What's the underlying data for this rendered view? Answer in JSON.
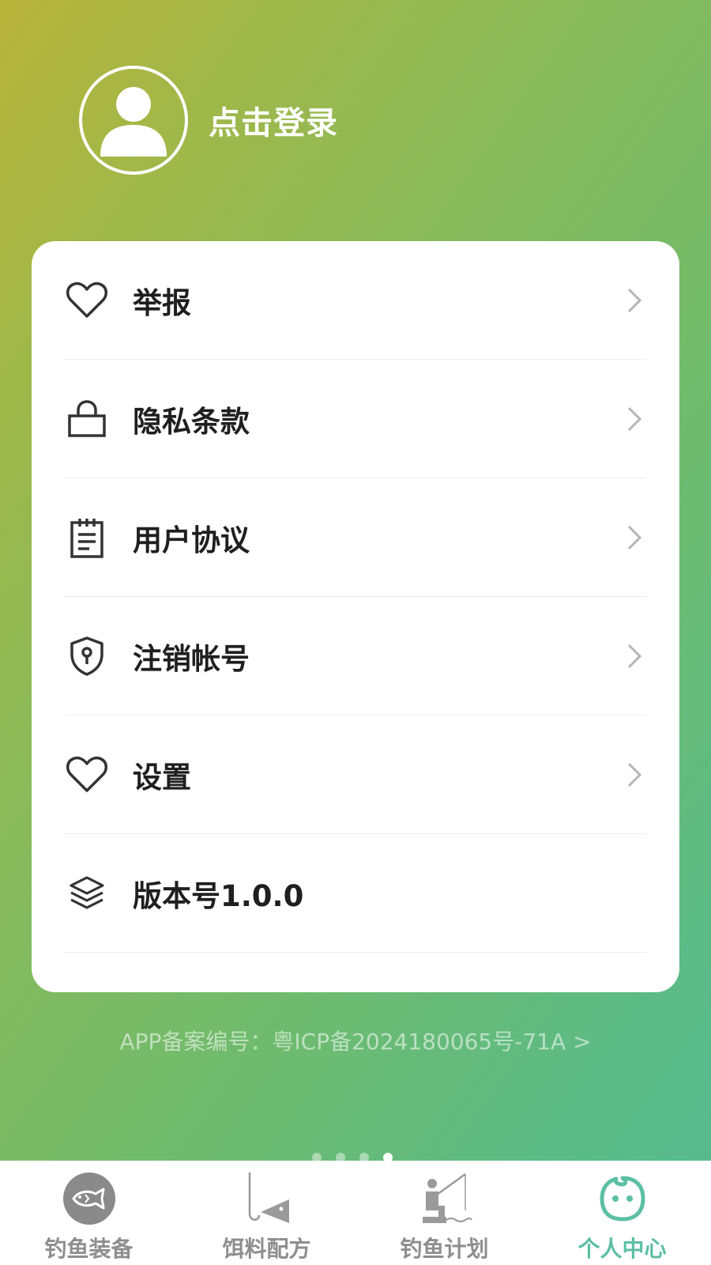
{
  "profile": {
    "login_label": "点击登录"
  },
  "menu": {
    "items": [
      {
        "label": "举报",
        "icon": "heart-icon"
      },
      {
        "label": "隐私条款",
        "icon": "lock-icon"
      },
      {
        "label": "用户协议",
        "icon": "notepad-icon"
      },
      {
        "label": "注销帐号",
        "icon": "shield-keyhole-icon"
      },
      {
        "label": "设置",
        "icon": "heart-icon"
      },
      {
        "label": "版本号1.0.0",
        "icon": "layers-icon"
      }
    ]
  },
  "footer": {
    "icp": "APP备案编号：粤ICP备2024180065号-71A >"
  },
  "tabs": [
    {
      "label": "钓鱼装备",
      "icon": "fish-icon"
    },
    {
      "label": "饵料配方",
      "icon": "hook-bait-icon"
    },
    {
      "label": "钓鱼计划",
      "icon": "fisherman-icon"
    },
    {
      "label": "个人中心",
      "icon": "smiley-face-icon",
      "active": true
    }
  ],
  "colors": {
    "accent": "#5cbfa4",
    "tab_inactive": "#8e8e8e",
    "text": "#1f1f1f"
  }
}
